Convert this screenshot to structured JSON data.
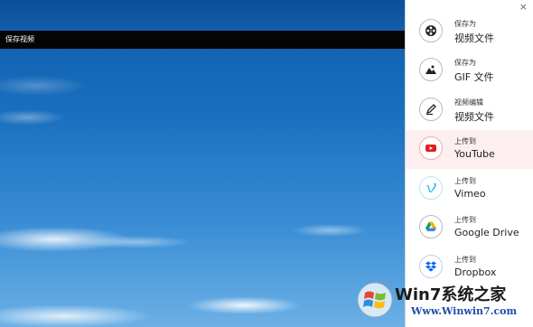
{
  "window": {
    "title": "保存视频"
  },
  "panel": {
    "close_label": "×",
    "items": [
      {
        "icon": "film-reel-icon",
        "line1": "保存为",
        "line2": "视频文件",
        "active": false
      },
      {
        "icon": "image-icon",
        "line1": "保存为",
        "line2": "GIF 文件",
        "active": false
      },
      {
        "icon": "edit-pen-icon",
        "line1": "视频编辑",
        "line2": "视频文件",
        "active": false
      },
      {
        "icon": "youtube-icon",
        "line1": "上传到",
        "line2": "YouTube",
        "active": true
      },
      {
        "icon": "vimeo-icon",
        "line1": "上传到",
        "line2": "Vimeo",
        "active": false
      },
      {
        "icon": "google-drive-icon",
        "line1": "上传到",
        "line2": "Google Drive",
        "active": false
      },
      {
        "icon": "dropbox-icon",
        "line1": "上传到",
        "line2": "Dropbox",
        "active": false
      }
    ]
  },
  "watermark": {
    "title": "Win7系统之家",
    "url": "Www.Winwin7.com"
  },
  "colors": {
    "active_bg": "#fdeef0",
    "youtube": "#e02020",
    "vimeo": "#19b7ea",
    "dropbox": "#0061fe"
  }
}
